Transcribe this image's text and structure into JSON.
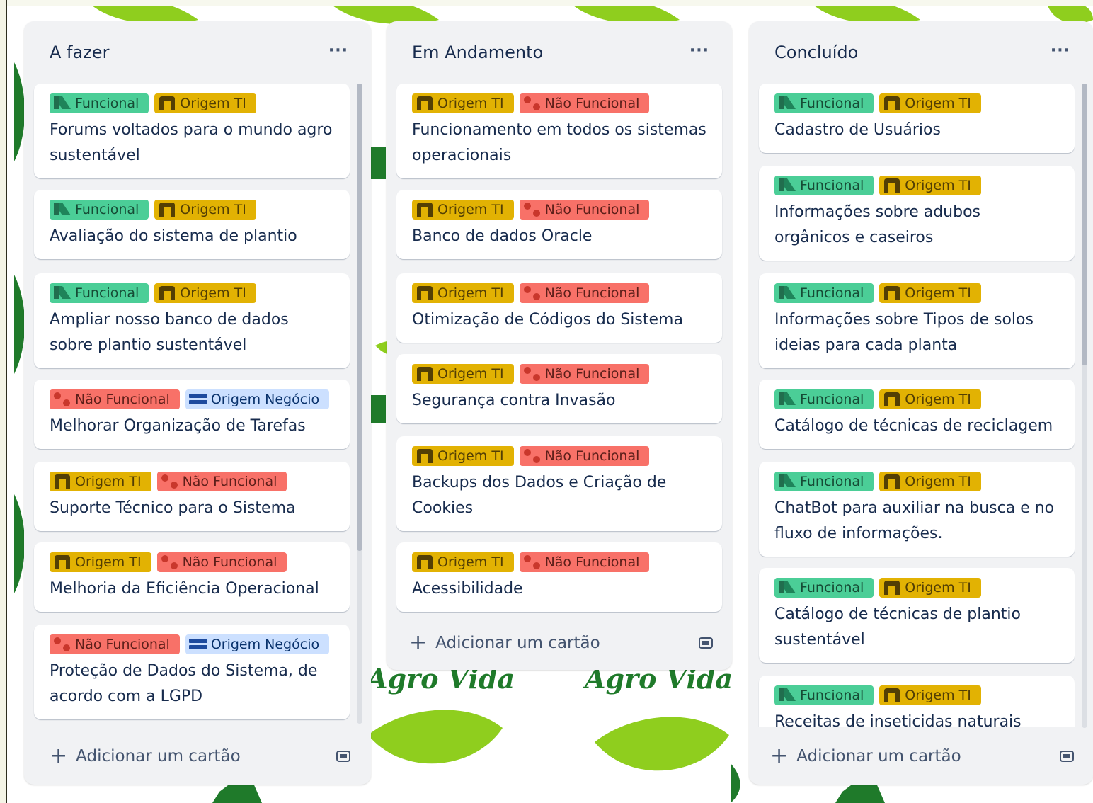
{
  "brand_text": "Agro Vida",
  "colors": {
    "functional": "#4bce97",
    "origem_ti": "#e2b203",
    "nao_funcional": "#f87168",
    "origem_negocio": "#cce0ff",
    "background_leaf_light": "#8fce1e",
    "background_leaf_dark": "#1f7a2a"
  },
  "columns": [
    {
      "title": "A fazer",
      "more_label": "···",
      "add_card_label": "Adicionar um cartão",
      "cards": [
        {
          "labels": [
            {
              "type": "func",
              "text": "Funcional"
            },
            {
              "type": "ti",
              "text": "Origem TI"
            }
          ],
          "title": "Forums voltados para o mundo agro sustentável"
        },
        {
          "labels": [
            {
              "type": "func",
              "text": "Funcional"
            },
            {
              "type": "ti",
              "text": "Origem TI"
            }
          ],
          "title": "Avaliação do sistema de plantio"
        },
        {
          "labels": [
            {
              "type": "func",
              "text": "Funcional"
            },
            {
              "type": "ti",
              "text": "Origem TI"
            }
          ],
          "title": "Ampliar nosso banco de dados sobre plantio sustentável"
        },
        {
          "labels": [
            {
              "type": "nf",
              "text": "Não Funcional"
            },
            {
              "type": "neg",
              "text": "Origem Negócio"
            }
          ],
          "title": "Melhorar Organização de Tarefas"
        },
        {
          "labels": [
            {
              "type": "ti",
              "text": "Origem TI"
            },
            {
              "type": "nf",
              "text": "Não Funcional"
            }
          ],
          "title": "Suporte Técnico para o Sistema"
        },
        {
          "labels": [
            {
              "type": "ti",
              "text": "Origem TI"
            },
            {
              "type": "nf",
              "text": "Não Funcional"
            }
          ],
          "title": "Melhoria da Eficiência Operacional"
        },
        {
          "labels": [
            {
              "type": "nf",
              "text": "Não Funcional"
            },
            {
              "type": "neg",
              "text": "Origem Negócio"
            }
          ],
          "title": "Proteção de Dados do Sistema, de acordo com a LGPD"
        }
      ]
    },
    {
      "title": "Em Andamento",
      "more_label": "···",
      "add_card_label": "Adicionar um cartão",
      "cards": [
        {
          "labels": [
            {
              "type": "ti",
              "text": "Origem TI"
            },
            {
              "type": "nf",
              "text": "Não Funcional"
            }
          ],
          "title": "Funcionamento em todos os sistemas operacionais"
        },
        {
          "labels": [
            {
              "type": "ti",
              "text": "Origem TI"
            },
            {
              "type": "nf",
              "text": "Não Funcional"
            }
          ],
          "title": "Banco de dados Oracle"
        },
        {
          "labels": [
            {
              "type": "ti",
              "text": "Origem TI"
            },
            {
              "type": "nf",
              "text": "Não Funcional"
            }
          ],
          "title": "Otimização de Códigos do Sistema"
        },
        {
          "labels": [
            {
              "type": "ti",
              "text": "Origem TI"
            },
            {
              "type": "nf",
              "text": "Não Funcional"
            }
          ],
          "title": "Segurança contra Invasão"
        },
        {
          "labels": [
            {
              "type": "ti",
              "text": "Origem TI"
            },
            {
              "type": "nf",
              "text": "Não Funcional"
            }
          ],
          "title": "Backups dos Dados e Criação de Cookies"
        },
        {
          "labels": [
            {
              "type": "ti",
              "text": "Origem TI"
            },
            {
              "type": "nf",
              "text": "Não Funcional"
            }
          ],
          "title": "Acessibilidade"
        }
      ]
    },
    {
      "title": "Concluído",
      "more_label": "···",
      "add_card_label": "Adicionar um cartão",
      "cards": [
        {
          "labels": [
            {
              "type": "func",
              "text": "Funcional"
            },
            {
              "type": "ti",
              "text": "Origem TI"
            }
          ],
          "title": "Cadastro de Usuários"
        },
        {
          "labels": [
            {
              "type": "func",
              "text": "Funcional"
            },
            {
              "type": "ti",
              "text": "Origem TI"
            }
          ],
          "title": "Informações sobre adubos orgânicos e caseiros"
        },
        {
          "labels": [
            {
              "type": "func",
              "text": "Funcional"
            },
            {
              "type": "ti",
              "text": "Origem TI"
            }
          ],
          "title": "Informações sobre Tipos de solos ideias para cada planta"
        },
        {
          "labels": [
            {
              "type": "func",
              "text": "Funcional"
            },
            {
              "type": "ti",
              "text": "Origem TI"
            }
          ],
          "title": "Catálogo de técnicas de reciclagem"
        },
        {
          "labels": [
            {
              "type": "func",
              "text": "Funcional"
            },
            {
              "type": "ti",
              "text": "Origem TI"
            }
          ],
          "title": "ChatBot para auxiliar na busca e no fluxo de informações."
        },
        {
          "labels": [
            {
              "type": "func",
              "text": "Funcional"
            },
            {
              "type": "ti",
              "text": "Origem TI"
            }
          ],
          "title": "Catálogo de técnicas de plantio sustentável"
        },
        {
          "labels": [
            {
              "type": "func",
              "text": "Funcional"
            },
            {
              "type": "ti",
              "text": "Origem TI"
            }
          ],
          "title": "Receitas de inseticidas naturais"
        }
      ]
    }
  ]
}
